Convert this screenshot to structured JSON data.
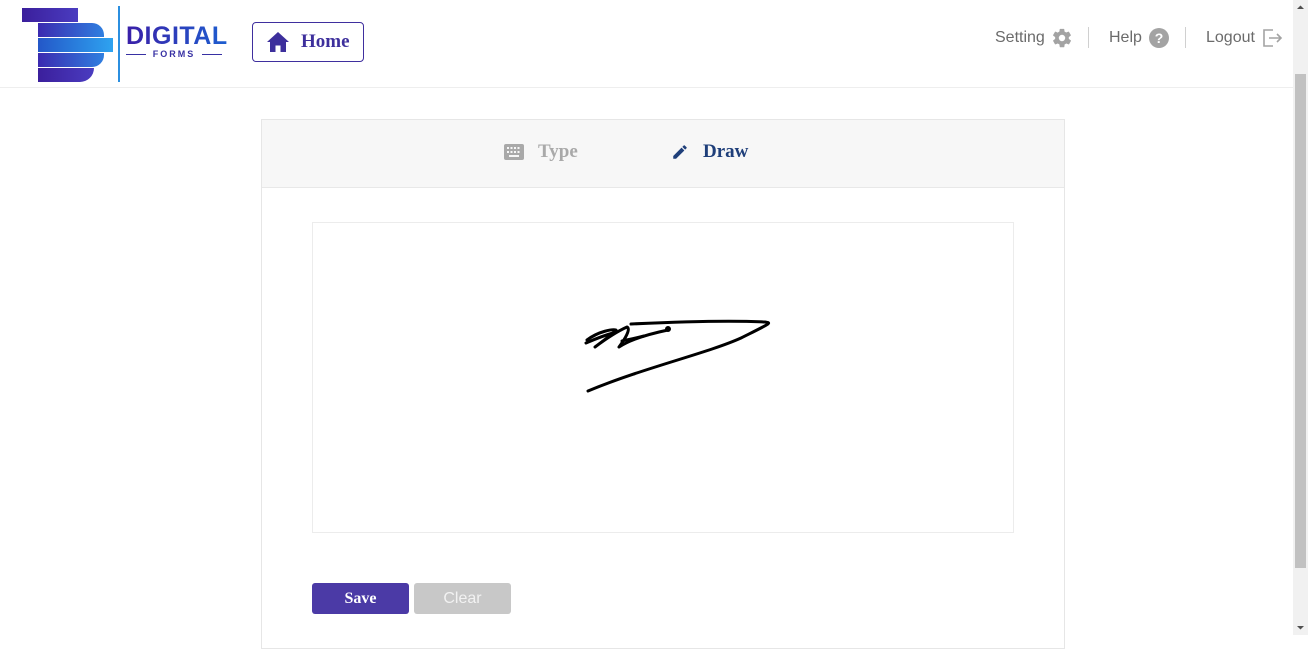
{
  "header": {
    "logo": {
      "title": "DIGITAL",
      "subtitle": "FORMS"
    },
    "home": {
      "label": "Home",
      "icon": "home-icon"
    },
    "nav": {
      "setting": {
        "label": "Setting",
        "icon": "gear-icon"
      },
      "help": {
        "label": "Help",
        "icon": "question-circle-icon"
      },
      "logout": {
        "label": "Logout",
        "icon": "logout-icon"
      }
    }
  },
  "signature": {
    "tabs": [
      {
        "label": "Type",
        "icon": "keyboard-icon",
        "active": false
      },
      {
        "label": "Draw",
        "icon": "pencil-icon",
        "active": true
      }
    ],
    "save_label": "Save",
    "clear_label": "Clear"
  },
  "colors": {
    "brand_primary": "#4b3aa6",
    "brand_dark": "#3d2f9c",
    "active_tab": "#1f3f7a",
    "inactive_tab": "#a9a9a9",
    "disabled_button": "#c8c8c8",
    "logo_blue": "#2b8fe0"
  }
}
